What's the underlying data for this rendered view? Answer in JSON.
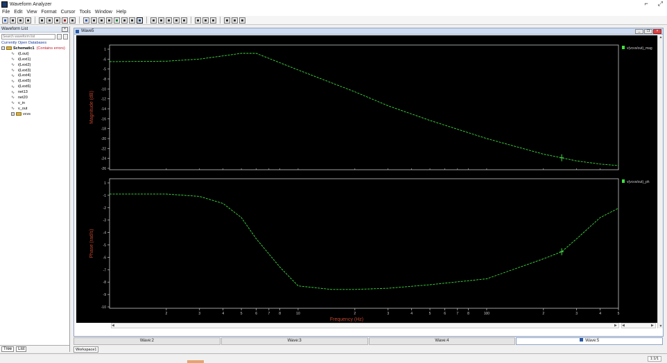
{
  "window": {
    "title": "Waveform Analyzer"
  },
  "menu": [
    "File",
    "Edit",
    "View",
    "Format",
    "Cursor",
    "Tools",
    "Window",
    "Help"
  ],
  "left_panel": {
    "header": "Waveform List",
    "search_placeholder": "Search waveform list",
    "section_title": "Currently Open Databases",
    "tree": [
      {
        "label": "Schematic1",
        "level": 0,
        "kind": "folder",
        "expanded": true,
        "note": "(Contains errors)"
      },
      {
        "label": "i(Lout)",
        "level": 1,
        "kind": "wave"
      },
      {
        "label": "i(Lext1)",
        "level": 1,
        "kind": "wave"
      },
      {
        "label": "i(Lext2)",
        "level": 1,
        "kind": "wave"
      },
      {
        "label": "i(Lext3)",
        "level": 1,
        "kind": "wave"
      },
      {
        "label": "i(Lext4)",
        "level": 1,
        "kind": "wave"
      },
      {
        "label": "i(Lext5)",
        "level": 1,
        "kind": "wave"
      },
      {
        "label": "i(Lext6)",
        "level": 1,
        "kind": "wave"
      },
      {
        "label": "net13",
        "level": 1,
        "kind": "wave"
      },
      {
        "label": "net20",
        "level": 1,
        "kind": "wave"
      },
      {
        "label": "v_in",
        "level": 1,
        "kind": "wave"
      },
      {
        "label": "v_out",
        "level": 1,
        "kind": "wave"
      },
      {
        "label": "vcvs",
        "level": 1,
        "kind": "folder",
        "expanded": false
      }
    ],
    "bottom_tabs": [
      "Tree",
      "List"
    ]
  },
  "mdi": {
    "title": "Wave5"
  },
  "doc_tabs": [
    {
      "label": "Wave:2",
      "active": false
    },
    {
      "label": "Wave:3",
      "active": false
    },
    {
      "label": "Wave:4",
      "active": false
    },
    {
      "label": "Wave:5",
      "active": true
    }
  ],
  "workspace_tab": "Workspace1",
  "status": {
    "right": "1:1/1"
  },
  "colors": {
    "plot_bg": "#000000",
    "trace": "#3ee03e",
    "axis": "#c8c8c8",
    "axis_label": "#c0452c",
    "accent": "#e3a46f"
  },
  "chart_data": [
    {
      "type": "line",
      "xlabel": "",
      "ylabel": "Magnitude (dB)",
      "y_tick_labels": [
        "1",
        "-6",
        "-5",
        "-8",
        "-10",
        "-12",
        "-14",
        "-16",
        "-18",
        "-20",
        "-22",
        "-24",
        "-26"
      ],
      "legend": [
        "v(vcvs/out)_mag"
      ],
      "x_scale": "log",
      "x": [
        1,
        2,
        3,
        5,
        6,
        10,
        20,
        30,
        50,
        100,
        200,
        250,
        300,
        400,
        500
      ],
      "y": [
        -6.7,
        -6.6,
        -6.2,
        -5.1,
        -5.1,
        -8.3,
        -12.5,
        -15.2,
        -18.0,
        -21.5,
        -24.5,
        -25.2,
        -25.8,
        -26.4,
        -26.7
      ],
      "xlim": [
        1,
        500
      ],
      "ylim": [
        -27.5,
        -3.5
      ],
      "marker_x": 250
    },
    {
      "type": "line",
      "xlabel": "Frequency (Hz)",
      "ylabel": "Phase (rad/s)",
      "y_tick_labels": [
        "1",
        "-1",
        "-2",
        "-3",
        "-4",
        "-5",
        "-6",
        "-7",
        "-8",
        "-9",
        "-10"
      ],
      "legend": [
        "v(vcvs/out)_ph"
      ],
      "x_tick_labels": [
        "2",
        "3",
        "4",
        "5",
        "6",
        "7",
        "8",
        "10",
        "2",
        "3",
        "4",
        "5",
        "6",
        "7",
        "8",
        "100",
        "2",
        "3",
        "4",
        "5"
      ],
      "x_scale": "log",
      "x": [
        1,
        2,
        3,
        4,
        5,
        6,
        8,
        10,
        15,
        20,
        30,
        50,
        100,
        200,
        250,
        300,
        400,
        500
      ],
      "y": [
        -1,
        -1,
        -1.2,
        -1.8,
        -3.0,
        -4.8,
        -7.2,
        -8.8,
        -9.1,
        -9.1,
        -9.0,
        -8.7,
        -8.2,
        -6.5,
        -5.9,
        -4.8,
        -3.0,
        -2.2
      ],
      "xlim": [
        1,
        500
      ],
      "ylim": [
        -10.7,
        0.3
      ],
      "marker_x": 250
    }
  ]
}
